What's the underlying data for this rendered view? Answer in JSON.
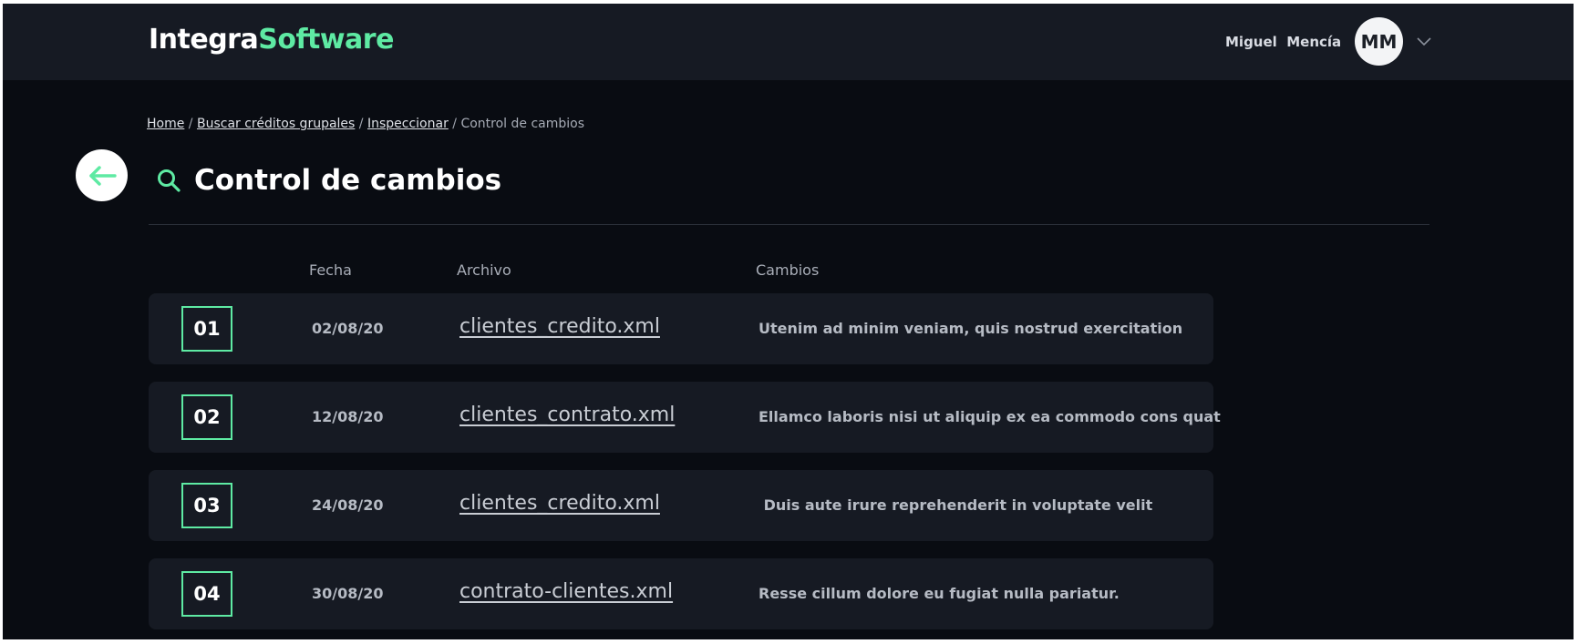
{
  "header": {
    "brand_primary": "Integra",
    "brand_accent": "Software",
    "user_name": "Miguel  Mencía",
    "avatar_initials": "MM"
  },
  "breadcrumb": {
    "items": [
      "Home",
      "Buscar créditos grupales",
      "Inspeccionar"
    ],
    "separator": "/",
    "current": "Control de cambios"
  },
  "page": {
    "title": "Control de cambios"
  },
  "table": {
    "columns": [
      "Fecha",
      "Archivo",
      "Cambios"
    ],
    "rows": [
      {
        "num": "01",
        "date": "02/08/20",
        "file": "clientes_credito.xml",
        "change": "Utenim ad minim veniam, quis nostrud exercitation"
      },
      {
        "num": "02",
        "date": "12/08/20",
        "file": "clientes_contrato.xml",
        "change": "Ellamco laboris nisi ut aliquip ex ea commodo cons quat"
      },
      {
        "num": "03",
        "date": "24/08/20",
        "file": "clientes_credito.xml",
        "change": " Duis aute irure reprehenderit in voluptate velit"
      },
      {
        "num": "04",
        "date": "30/08/20",
        "file": "contrato-clientes.xml",
        "change": "Resse cillum dolore eu fugiat nulla pariatur."
      }
    ]
  },
  "colors": {
    "accent": "#5eeaa3",
    "background": "#090c12",
    "surface": "#161a23"
  },
  "icons": {
    "back": "arrow-left-icon",
    "search": "search-icon",
    "user_menu": "chevron-down-icon"
  }
}
